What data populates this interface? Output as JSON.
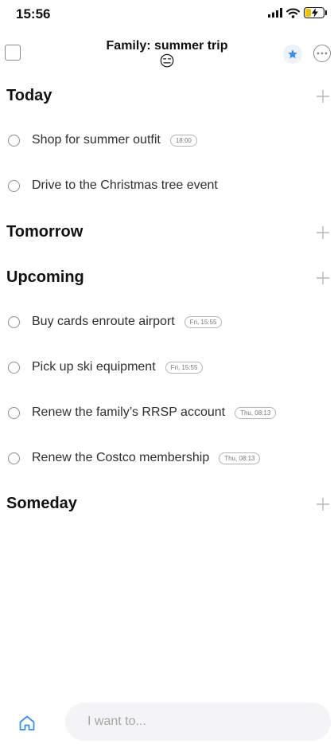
{
  "status_bar": {
    "time": "15:56"
  },
  "header": {
    "title": "Family: summer trip",
    "emoji": "😑"
  },
  "sections": {
    "today": {
      "title": "Today",
      "tasks": [
        {
          "label": "Shop for summer outfit",
          "time": "18:00"
        },
        {
          "label": "Drive to the Christmas tree event"
        }
      ]
    },
    "tomorrow": {
      "title": "Tomorrow"
    },
    "upcoming": {
      "title": "Upcoming",
      "tasks": [
        {
          "label": "Buy cards enroute airport",
          "time": "Fri, 15:55"
        },
        {
          "label": "Pick up ski equipment",
          "time": "Fri, 15:55"
        },
        {
          "label": "Renew the family’s RRSP account",
          "time": "Thu, 08:13"
        },
        {
          "label": "Renew the Costco membership",
          "time": "Thu, 08:13"
        }
      ]
    },
    "someday": {
      "title": "Someday"
    }
  },
  "input": {
    "placeholder": "I want to..."
  },
  "colors": {
    "accent": "#3a8ee6",
    "star_bg": "#eef1f8",
    "battery": "#f2c200"
  },
  "icons": {
    "add": "plus-icon",
    "more": "ellipsis-icon",
    "favorite": "star-icon",
    "home": "home-icon"
  }
}
